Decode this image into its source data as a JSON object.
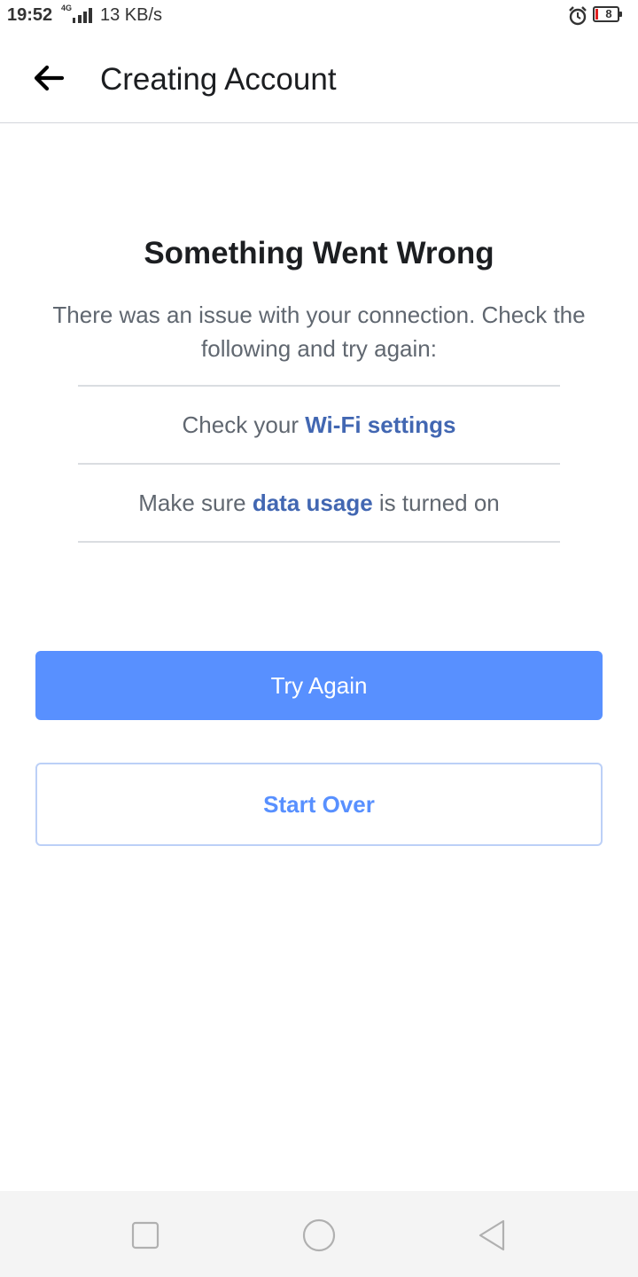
{
  "status_bar": {
    "time": "19:52",
    "network": "4G",
    "speed": "13 KB/s",
    "battery_level": "8",
    "icons": [
      "signal-icon",
      "alarm-icon",
      "battery-icon"
    ]
  },
  "app_bar": {
    "title": "Creating Account",
    "back_icon": "arrow-left-icon"
  },
  "error": {
    "title": "Something Went Wrong",
    "description": "There was an issue with your connection. Check the following and try again:",
    "checks": [
      {
        "prefix": "Check your ",
        "link": "Wi-Fi settings",
        "suffix": ""
      },
      {
        "prefix": "Make sure ",
        "link": "data usage",
        "suffix": " is turned on"
      }
    ]
  },
  "buttons": {
    "try_again": "Try Again",
    "start_over": "Start Over"
  },
  "nav_bar": {
    "icons": [
      "recent-apps-icon",
      "home-icon",
      "back-triangle-icon"
    ]
  },
  "colors": {
    "primary": "#5890ff",
    "link": "#4267b2",
    "battery_low": "#e02020"
  }
}
